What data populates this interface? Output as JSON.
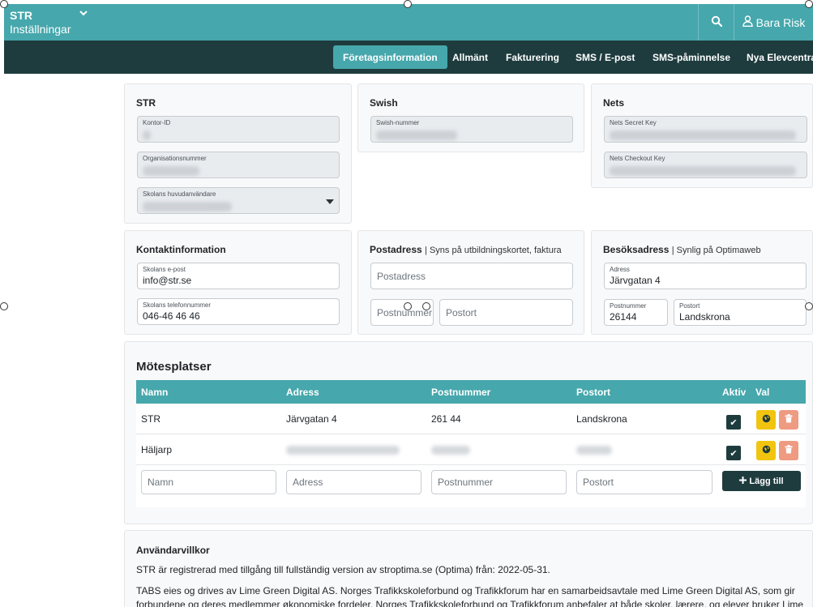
{
  "header": {
    "brand": "STR",
    "subtitle": "Inställningar",
    "user": "Bara Risk"
  },
  "nav": {
    "tabs": [
      "Företagsinformation",
      "Allmänt",
      "Fakturering",
      "SMS / E-post",
      "SMS-påminnelse",
      "Nya Elevcentra"
    ]
  },
  "str_card": {
    "title": "STR",
    "office_id_label": "Kontor-ID",
    "org_number_label": "Organisationsnummer",
    "main_user_label": "Skolans huvudanvändare"
  },
  "swish_card": {
    "title": "Swish",
    "swish_number_label": "Swish-nummer"
  },
  "nets_card": {
    "title": "Nets",
    "secret_key_label": "Nets Secret Key",
    "checkout_key_label": "Nets Checkout Key"
  },
  "contact_card": {
    "title": "Kontaktinformation",
    "email_label": "Skolans e-post",
    "email_value": "info@str.se",
    "phone_label": "Skolans telefonnummer",
    "phone_value": "046-46 46 46"
  },
  "postal_card": {
    "title": "Postadress",
    "subtitle": "| Syns på utbildningskortet, faktura",
    "address_placeholder": "Postadress",
    "zip_placeholder": "Postnummer",
    "city_placeholder": "Postort"
  },
  "visit_card": {
    "title": "Besöksadress",
    "subtitle": "| Synlig på Optimaweb",
    "address_label": "Adress",
    "address_value": "Järvgatan 4",
    "zip_label": "Postnummer",
    "zip_value": "26144",
    "city_label": "Postort",
    "city_value": "Landskrona"
  },
  "meetings": {
    "title": "Mötesplatser",
    "columns": [
      "Namn",
      "Adress",
      "Postnummer",
      "Postort",
      "Aktiv",
      "Val"
    ],
    "rows": [
      {
        "name": "STR",
        "address": "Järvgatan 4",
        "zip": "261 44",
        "city": "Landskrona",
        "active": true
      },
      {
        "name": "Häljarp",
        "address": "",
        "zip": "",
        "city": "",
        "active": true
      }
    ],
    "new": {
      "name_placeholder": "Namn",
      "address_placeholder": "Adress",
      "zip_placeholder": "Postnummer",
      "city_placeholder": "Postort",
      "add_label": "Lägg till"
    }
  },
  "terms": {
    "title": "Användarvillkor",
    "line1": "STR är registrerad med tillgång till fullständig version av stroptima.se (Optima) från: 2022-05-31.",
    "line2": "TABS eies og drives av Lime Green Digital AS. Norges Trafikkskoleforbund og Trafikkforum har en samarbeidsavtale med Lime Green Digital AS, som gir",
    "line3": "forbundene og deres medlemmer økonomiske fordeler. Norges Trafikkskoleforbund og Trafikkforum anbefaler at både skoler, lærere, og elever bruker Lime"
  },
  "colors": {
    "teal": "#46a7ac",
    "dark_teal": "#1e3c3e",
    "yellow": "#f1c40f",
    "salmon": "#ee9b82"
  }
}
